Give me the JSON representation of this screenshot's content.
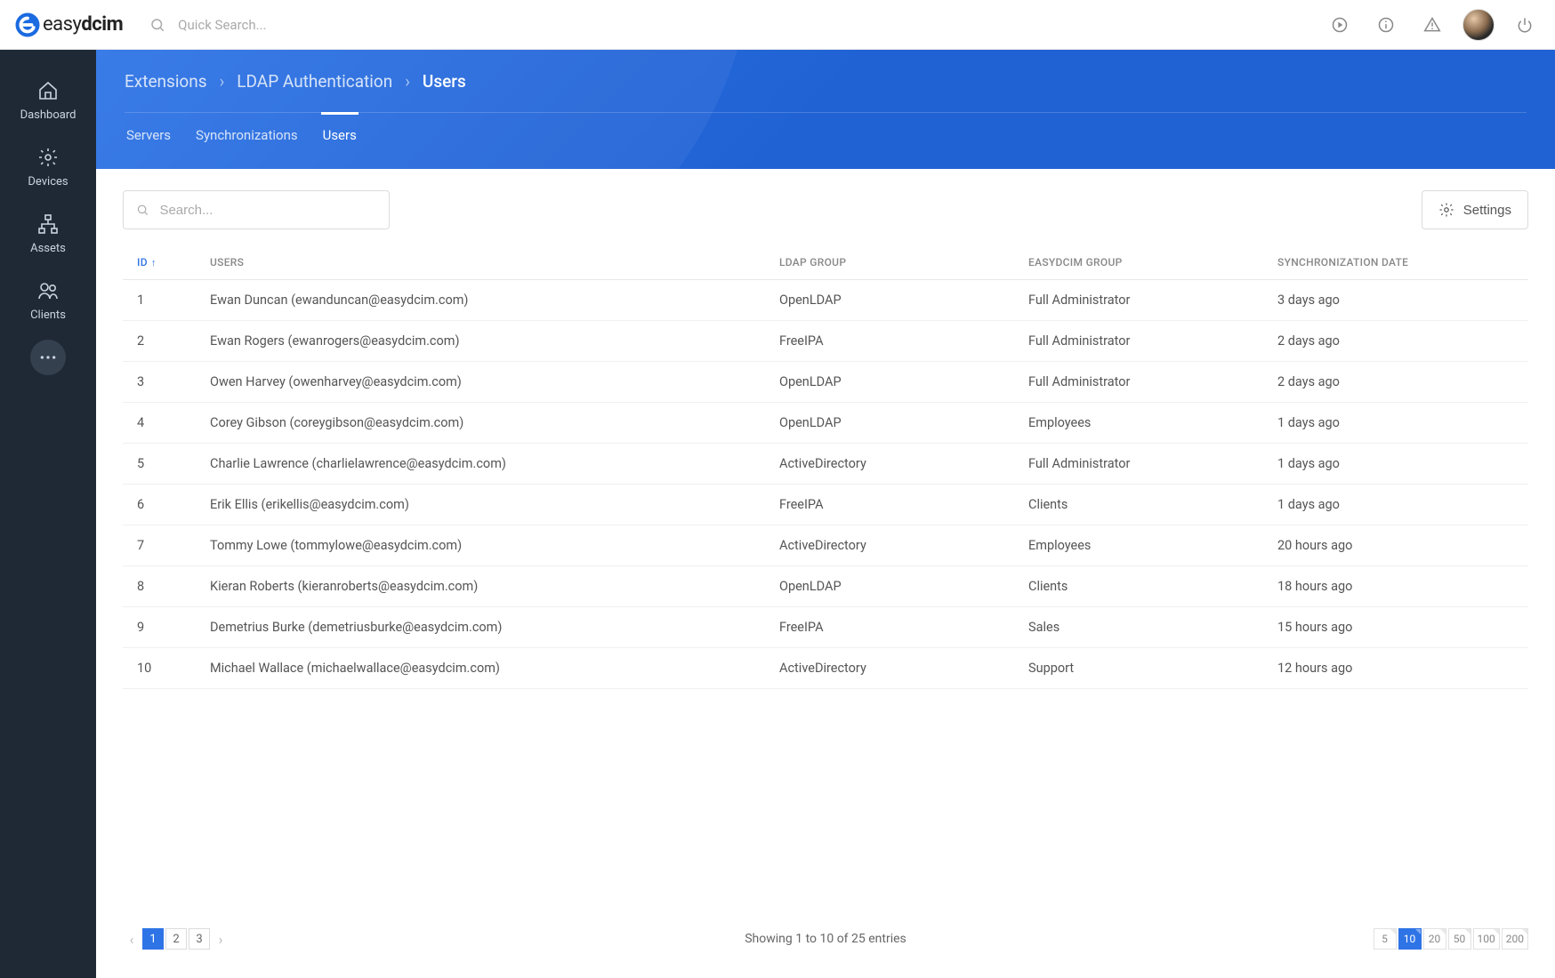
{
  "brand": {
    "name": "easydcim",
    "bold_part": "dcim"
  },
  "topbar": {
    "search_placeholder": "Quick Search...",
    "icons": [
      "play-circle-icon",
      "info-icon",
      "alert-triangle-icon",
      "power-icon"
    ]
  },
  "sidebar": {
    "items": [
      {
        "label": "Dashboard",
        "icon": "home-icon"
      },
      {
        "label": "Devices",
        "icon": "gear-icon"
      },
      {
        "label": "Assets",
        "icon": "network-icon"
      },
      {
        "label": "Clients",
        "icon": "users-icon"
      }
    ]
  },
  "breadcrumb": {
    "items": [
      "Extensions",
      "LDAP Authentication",
      "Users"
    ],
    "active_index": 2
  },
  "tabs": {
    "items": [
      "Servers",
      "Synchronizations",
      "Users"
    ],
    "active_index": 2
  },
  "toolbar": {
    "search_placeholder": "Search...",
    "settings_label": "Settings"
  },
  "table": {
    "columns": [
      {
        "key": "id",
        "label": "ID",
        "sorted": "asc"
      },
      {
        "key": "user",
        "label": "USERS"
      },
      {
        "key": "ldap_group",
        "label": "LDAP GROUP"
      },
      {
        "key": "easydcim_group",
        "label": "EASYDCIM GROUP"
      },
      {
        "key": "sync_date",
        "label": "SYNCHRONIZATION DATE"
      }
    ],
    "rows": [
      {
        "id": "1",
        "user": "Ewan Duncan (ewanduncan@easydcim.com)",
        "ldap_group": "OpenLDAP",
        "easydcim_group": "Full Administrator",
        "sync_date": "3 days ago"
      },
      {
        "id": "2",
        "user": "Ewan Rogers (ewanrogers@easydcim.com)",
        "ldap_group": "FreeIPA",
        "easydcim_group": "Full Administrator",
        "sync_date": "2 days ago"
      },
      {
        "id": "3",
        "user": "Owen Harvey (owenharvey@easydcim.com)",
        "ldap_group": "OpenLDAP",
        "easydcim_group": "Full Administrator",
        "sync_date": "2 days ago"
      },
      {
        "id": "4",
        "user": "Corey Gibson (coreygibson@easydcim.com)",
        "ldap_group": "OpenLDAP",
        "easydcim_group": "Employees",
        "sync_date": "1 days ago"
      },
      {
        "id": "5",
        "user": "Charlie Lawrence (charlielawrence@easydcim.com)",
        "ldap_group": "ActiveDirectory",
        "easydcim_group": "Full Administrator",
        "sync_date": "1 days ago"
      },
      {
        "id": "6",
        "user": "Erik Ellis (erikellis@easydcim.com)",
        "ldap_group": "FreeIPA",
        "easydcim_group": "Clients",
        "sync_date": "1 days ago"
      },
      {
        "id": "7",
        "user": "Tommy Lowe (tommylowe@easydcim.com)",
        "ldap_group": "ActiveDirectory",
        "easydcim_group": "Employees",
        "sync_date": "20 hours ago"
      },
      {
        "id": "8",
        "user": "Kieran Roberts (kieranroberts@easydcim.com)",
        "ldap_group": "OpenLDAP",
        "easydcim_group": "Clients",
        "sync_date": "18 hours ago"
      },
      {
        "id": "9",
        "user": "Demetrius Burke (demetriusburke@easydcim.com)",
        "ldap_group": "FreeIPA",
        "easydcim_group": "Sales",
        "sync_date": "15 hours ago"
      },
      {
        "id": "10",
        "user": "Michael Wallace (michaelwallace@easydcim.com)",
        "ldap_group": "ActiveDirectory",
        "easydcim_group": "Support",
        "sync_date": "12 hours ago"
      }
    ]
  },
  "pagination": {
    "pages": [
      "1",
      "2",
      "3"
    ],
    "active_page": "1",
    "summary": "Showing 1 to 10 of 25 entries",
    "sizes": [
      "5",
      "10",
      "20",
      "50",
      "100",
      "200"
    ],
    "active_size": "10"
  }
}
